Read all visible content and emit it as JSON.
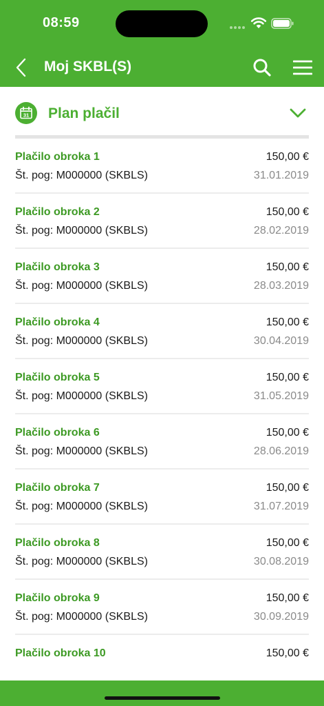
{
  "status_bar": {
    "time": "08:59"
  },
  "nav": {
    "title": "Moj SKBL(S)",
    "back_icon": "chevron-left-icon",
    "search_icon": "search-icon",
    "menu_icon": "hamburger-menu-icon"
  },
  "section": {
    "title": "Plan plačil",
    "icon": "calendar-icon",
    "calendar_day": "31",
    "toggle_icon": "chevron-down-icon"
  },
  "colors": {
    "brand_green": "#4caf32",
    "title_green": "#3d9a24",
    "date_gray": "#8a8a8a"
  },
  "payments": [
    {
      "title": "Plačilo obroka 1",
      "amount": "150,00 €",
      "contract": "Št. pog: M000000 (SKBLS)",
      "date": "31.01.2019"
    },
    {
      "title": "Plačilo obroka 2",
      "amount": "150,00 €",
      "contract": "Št. pog: M000000 (SKBLS)",
      "date": "28.02.2019"
    },
    {
      "title": "Plačilo obroka 3",
      "amount": "150,00 €",
      "contract": "Št. pog: M000000 (SKBLS)",
      "date": "28.03.2019"
    },
    {
      "title": "Plačilo obroka 4",
      "amount": "150,00 €",
      "contract": "Št. pog: M000000 (SKBLS)",
      "date": "30.04.2019"
    },
    {
      "title": "Plačilo obroka 5",
      "amount": "150,00 €",
      "contract": "Št. pog: M000000 (SKBLS)",
      "date": "31.05.2019"
    },
    {
      "title": "Plačilo obroka 6",
      "amount": "150,00 €",
      "contract": "Št. pog: M000000 (SKBLS)",
      "date": "28.06.2019"
    },
    {
      "title": "Plačilo obroka 7",
      "amount": "150,00 €",
      "contract": "Št. pog: M000000 (SKBLS)",
      "date": "31.07.2019"
    },
    {
      "title": "Plačilo obroka 8",
      "amount": "150,00 €",
      "contract": "Št. pog: M000000 (SKBLS)",
      "date": "30.08.2019"
    },
    {
      "title": "Plačilo obroka 9",
      "amount": "150,00 €",
      "contract": "Št. pog: M000000 (SKBLS)",
      "date": "30.09.2019"
    },
    {
      "title": "Plačilo obroka 10",
      "amount": "150,00 €",
      "contract": "",
      "date": ""
    }
  ]
}
